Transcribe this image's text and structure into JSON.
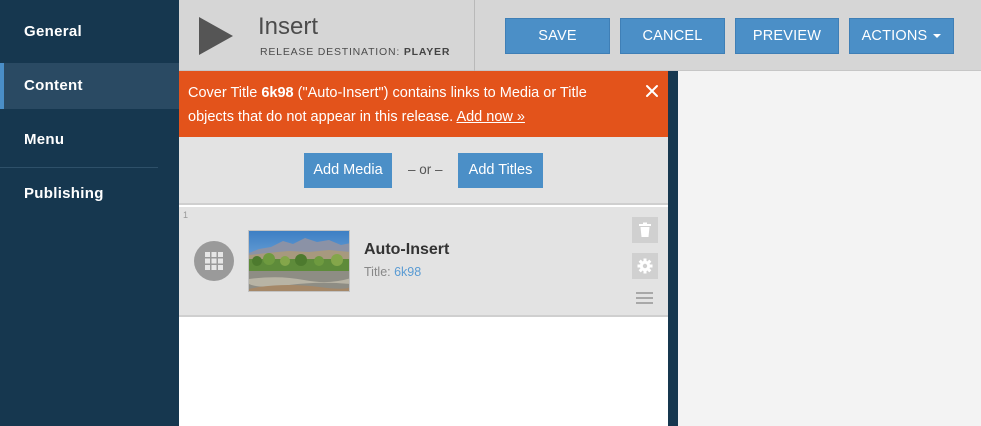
{
  "sidebar": {
    "items": [
      {
        "label": "General"
      },
      {
        "label": "Content"
      },
      {
        "label": "Menu"
      },
      {
        "label": "Publishing"
      }
    ]
  },
  "header": {
    "title": "Insert",
    "subtitle_label": "RELEASE DESTINATION:",
    "subtitle_value": "PLAYER",
    "buttons": {
      "save": "SAVE",
      "cancel": "CANCEL",
      "preview": "PREVIEW",
      "actions": "ACTIONS"
    }
  },
  "alert": {
    "prefix": "Cover Title",
    "title_id": "6k98",
    "middle": "(\"Auto-Insert\") contains links to Media or Title objects that do not appear in this release.",
    "link": "Add now »"
  },
  "add_bar": {
    "add_media": "Add Media",
    "or": "– or –",
    "add_titles": "Add Titles"
  },
  "rows": [
    {
      "index": "1",
      "title": "Auto-Insert",
      "sub_label": "Title:",
      "sub_value": "6k98"
    }
  ],
  "icons": {
    "play": "play-icon",
    "close": "close-icon",
    "grid": "grid-icon",
    "trash": "trash-icon",
    "gear": "gear-icon",
    "drag": "drag-handle-icon"
  },
  "colors": {
    "sidebar_bg": "#16374f",
    "accent_blue": "#4b8fc7",
    "alert_orange": "#e3531b",
    "header_bg": "#d6d6d6"
  }
}
